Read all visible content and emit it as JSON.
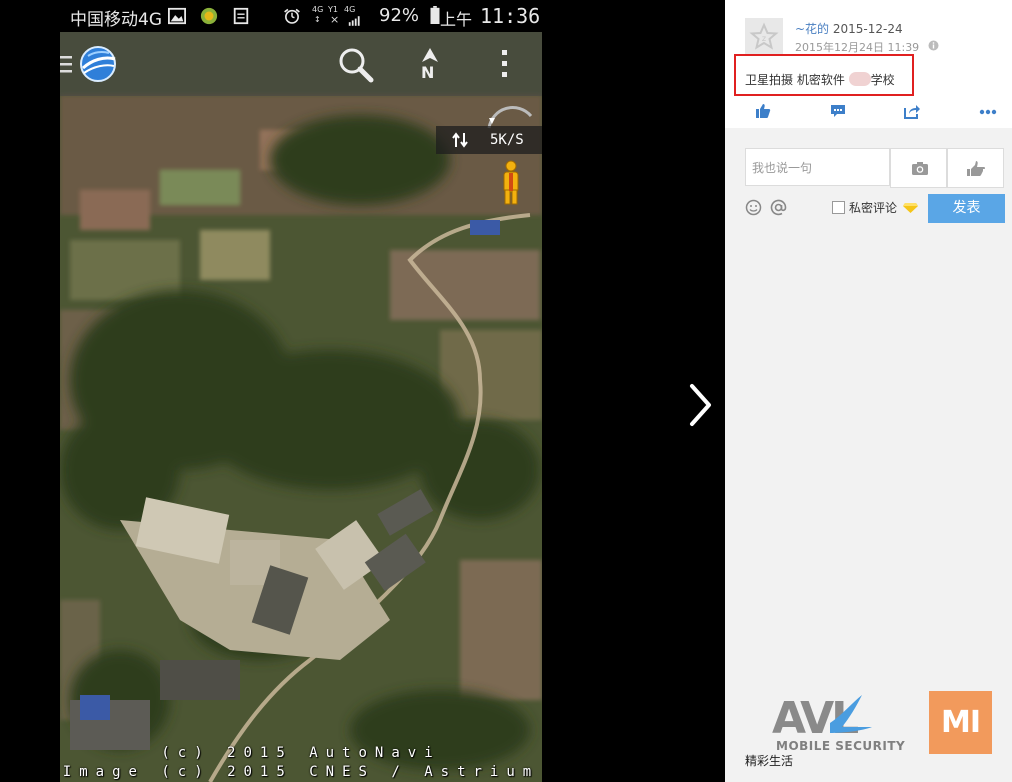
{
  "status_bar": {
    "carrier": "中国移动4G",
    "battery": "92%",
    "ampm": "上午",
    "time": "11:36",
    "net_top": "4G",
    "net_bottom": "↕",
    "signal_label_a": "Y1",
    "signal_label_b": "4G"
  },
  "map_app": {
    "compass_label": "N",
    "speed": "5K/S",
    "copyright_line1": "(c) 2015 AutoNavi",
    "copyright_line2": "Image (c) 2015 CNES / Astrium"
  },
  "post": {
    "author_name": "~花的",
    "date": "2015-12-24",
    "timestamp": "2015年12月24日 11:39",
    "text_before": "卫星拍摄 机密软件",
    "text_after": "学校"
  },
  "comment": {
    "placeholder": "我也说一句",
    "private_label": "私密评论",
    "submit_label": "发表"
  },
  "footer": {
    "logo_avl": "AVL",
    "logo_avl_sub": "MOBILE SECURITY",
    "logo_mi": "MI",
    "caption": "精彩生活"
  },
  "colors": {
    "accent_blue": "#4a7fc1",
    "submit_blue": "#5aa6e6",
    "highlight_red": "#e02020",
    "mi_orange": "#f29a5c"
  }
}
